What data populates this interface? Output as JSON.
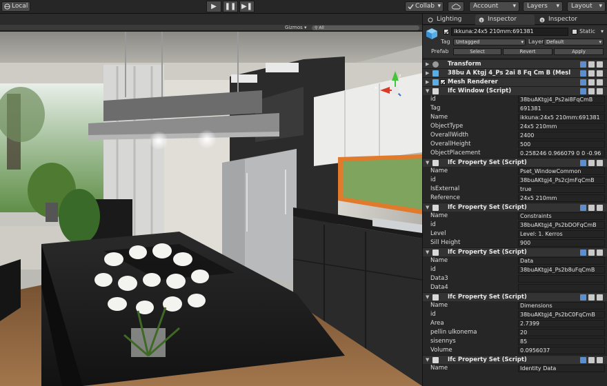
{
  "toolbar": {
    "local_label": "Local",
    "collab_label": "Collab",
    "account_label": "Account",
    "layers_label": "Layers",
    "layout_label": "Layout"
  },
  "scene": {
    "gizmos_label": "Gizmos",
    "search_placeholder": "All"
  },
  "tabs": [
    {
      "label": "Lighting"
    },
    {
      "label": "Inspector"
    },
    {
      "label": "Inspector"
    }
  ],
  "object": {
    "name": "ikkuna:24x5 210mm:691381",
    "static_label": "Static",
    "tag_label": "Tag",
    "tag_value": "Untagged",
    "layer_label": "Layer",
    "layer_value": "Default",
    "prefab_label": "Prefab",
    "select_label": "Select",
    "revert_label": "Revert",
    "apply_label": "Apply"
  },
  "components": [
    {
      "title": "Transform",
      "icon": "transform-icon",
      "checkbox": false,
      "props": []
    },
    {
      "title": "38bu A Ktgj 4_Ps 2ai 8 Fq Cm B (Mesl",
      "icon": "mesh-filter-icon",
      "checkbox": false,
      "props": []
    },
    {
      "title": "Mesh Renderer",
      "icon": "mesh-renderer-icon",
      "checkbox": true,
      "props": []
    },
    {
      "title": "Ifc Window (Script)",
      "icon": "script-icon",
      "checkbox": false,
      "props": [
        {
          "k": "id",
          "v": "38buAKtgj4_Ps2ai8FqCmB"
        },
        {
          "k": "Tag",
          "v": "691381"
        },
        {
          "k": "Name",
          "v": "ikkuna:24x5 210mm:691381"
        },
        {
          "k": "ObjectType",
          "v": "24x5 210mm"
        },
        {
          "k": "OverallWidth",
          "v": "2400"
        },
        {
          "k": "OverallHeight",
          "v": "500"
        },
        {
          "k": "ObjectPlacement",
          "v": "0.258246 0.966079 0 0 -0.96"
        }
      ]
    },
    {
      "title": "Ifc Property Set (Script)",
      "icon": "script-icon",
      "checkbox": false,
      "props": [
        {
          "k": "Name",
          "v": "Pset_WindowCommon"
        },
        {
          "k": "id",
          "v": "38buAKtgj4_Ps2cJmFqCmB"
        },
        {
          "k": "IsExternal",
          "v": "true"
        },
        {
          "k": "Reference",
          "v": "24x5 210mm"
        }
      ]
    },
    {
      "title": "Ifc Property Set (Script)",
      "icon": "script-icon",
      "checkbox": false,
      "props": [
        {
          "k": "Name",
          "v": "Constraints"
        },
        {
          "k": "id",
          "v": "38buAKtgj4_Ps2bDOFqCmB"
        },
        {
          "k": "Level",
          "v": "Level: 1. Kerros"
        },
        {
          "k": "Sill Height",
          "v": "900"
        }
      ]
    },
    {
      "title": "Ifc Property Set (Script)",
      "icon": "script-icon",
      "checkbox": false,
      "props": [
        {
          "k": "Name",
          "v": "Data"
        },
        {
          "k": "id",
          "v": "38buAKtgj4_Ps2b8uFqCmB"
        },
        {
          "k": "Data3",
          "v": ""
        },
        {
          "k": "Data4",
          "v": ""
        }
      ]
    },
    {
      "title": "Ifc Property Set (Script)",
      "icon": "script-icon",
      "checkbox": false,
      "props": [
        {
          "k": "Name",
          "v": "Dimensions"
        },
        {
          "k": "id",
          "v": "38buAKtgj4_Ps2bC0FqCmB"
        },
        {
          "k": "Area",
          "v": "2.7399"
        },
        {
          "k": "pellin ulkonema",
          "v": "20"
        },
        {
          "k": "sisennys",
          "v": "85"
        },
        {
          "k": "Volume",
          "v": "0.0956037"
        }
      ]
    },
    {
      "title": "Ifc Property Set (Script)",
      "icon": "script-icon",
      "checkbox": false,
      "props": [
        {
          "k": "Name",
          "v": "Identity Data"
        }
      ]
    }
  ],
  "colors": {
    "panel_bg": "#262626",
    "header_bg": "#333333",
    "field_bg": "#242424",
    "gizmo_x": "#d83a2a",
    "gizmo_y": "#43c43b",
    "gizmo_z": "#3a6ed8"
  }
}
